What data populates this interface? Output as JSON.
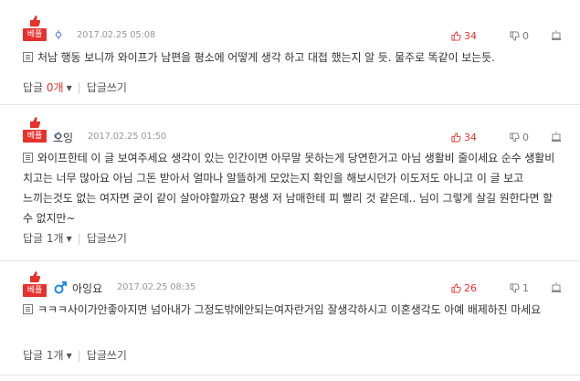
{
  "badge_label": "베플",
  "comments": [
    {
      "nickname": "",
      "date": "2017.02.25 05:08",
      "up": "34",
      "down": "0",
      "text": "처남 행동 보니까 와이프가 남편을 평소에 어떻게 생각 하고 대접 했는지 알 듯. 물주로 똑같이 보는듯.",
      "reply_label": "답글",
      "reply_count": "0개",
      "write_reply": "답글쓰기"
    },
    {
      "nickname": "으잉",
      "date": "2017.02.25 01:50",
      "up": "34",
      "down": "0",
      "text": "와이프한테 이 글 보여주세요 생각이 있는 인간이면 아무말 못하는게 당연한거고 아님 생활비 줄이세요 순수 생활비 치고는 너무 많아요 아님 그돈 받아서 얼마나 알뜰하게 모았는지 확인을 해보시던가 이도저도 아니고 이 글 보고 느끼는것도 없는 여자면 굳이 같이 살아야할까요? 평생 저 남매한테 피 빨리 것 같은데.. 님이 그렇게 살길 원한다면 할 수 없지만~",
      "reply_label": "답글",
      "reply_count": "1개",
      "write_reply": "답글쓰기"
    },
    {
      "nickname": "아잉요",
      "date": "2017.02.25 08:35",
      "up": "26",
      "down": "1",
      "text": "ㅋㅋㅋ사이가안좋아지면 넘아내가 그정도밖에안되는여자란거임 잘생각하시고 이혼생각도 아예 배제하진 마세요",
      "reply_label": "답글",
      "reply_count": "1개",
      "write_reply": "답글쓰기"
    }
  ],
  "colors": {
    "accent": "#e6322d",
    "male": "#1e88e5",
    "neutral_gender": "#5b8bd0"
  },
  "icons": [
    "thumbs-up-icon",
    "thumbs-down-icon",
    "report-icon",
    "male-icon",
    "neutral-gender-icon",
    "doc-icon"
  ]
}
